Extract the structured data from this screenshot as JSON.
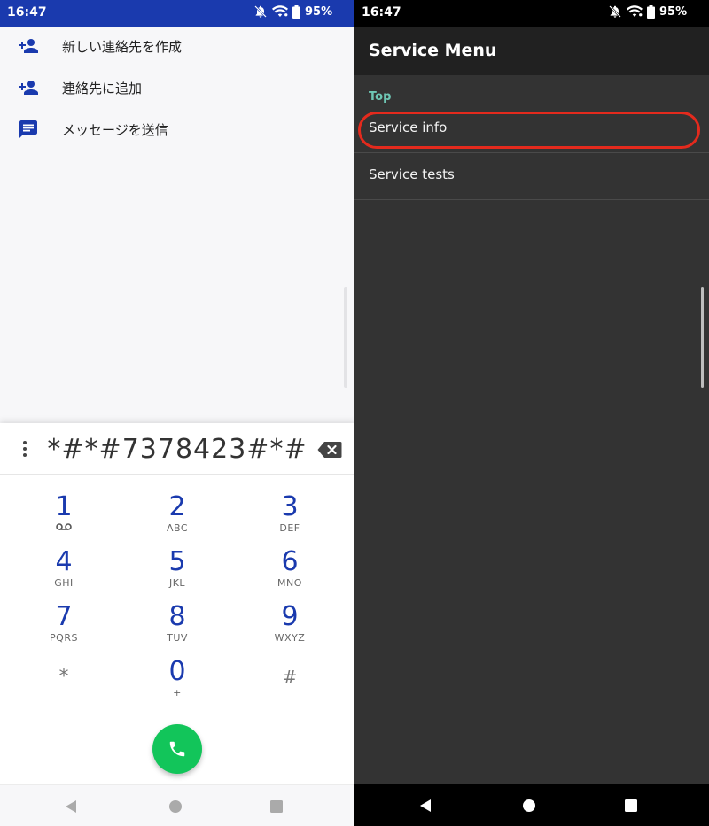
{
  "left_screen": {
    "status_bar": {
      "time": "16:47",
      "battery": "95%",
      "bg_color": "#1a3aae"
    },
    "suggestions": [
      {
        "icon": "person-add-icon",
        "label": "新しい連絡先を作成"
      },
      {
        "icon": "person-add-icon",
        "label": "連絡先に追加"
      },
      {
        "icon": "message-icon",
        "label": "メッセージを送信"
      }
    ],
    "dialer": {
      "number": "*#*#7378423#*#",
      "keys": [
        {
          "digit": "1",
          "letters": "",
          "voicemail": true
        },
        {
          "digit": "2",
          "letters": "ABC"
        },
        {
          "digit": "3",
          "letters": "DEF"
        },
        {
          "digit": "4",
          "letters": "GHI"
        },
        {
          "digit": "5",
          "letters": "JKL"
        },
        {
          "digit": "6",
          "letters": "MNO"
        },
        {
          "digit": "7",
          "letters": "PQRS"
        },
        {
          "digit": "8",
          "letters": "TUV"
        },
        {
          "digit": "9",
          "letters": "WXYZ"
        },
        {
          "digit": "*",
          "letters": ""
        },
        {
          "digit": "0",
          "letters": "+"
        },
        {
          "digit": "#",
          "letters": ""
        }
      ],
      "digit_color": "#1a3aae",
      "call_color": "#12c55a"
    }
  },
  "right_screen": {
    "status_bar": {
      "time": "16:47",
      "battery": "95%"
    },
    "app_bar": {
      "title": "Service Menu"
    },
    "section": "Top",
    "menu_items": [
      {
        "label": "Service info",
        "highlighted": true
      },
      {
        "label": "Service tests",
        "highlighted": false
      }
    ],
    "highlight_color": "#e42a1d",
    "section_color": "#6ec6b4"
  }
}
